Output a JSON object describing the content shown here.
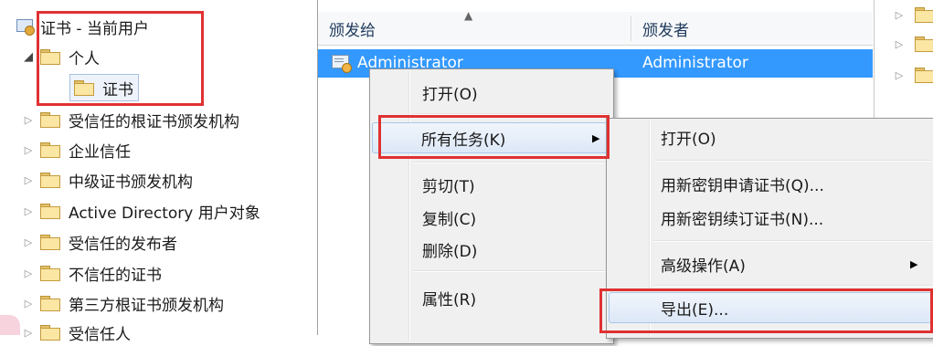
{
  "tree": {
    "root_label": "证书 - 当前用户",
    "personal_label": "个人",
    "certificates_label": "证书",
    "folders": [
      {
        "label": "受信任的根证书颁发机构"
      },
      {
        "label": "企业信任"
      },
      {
        "label": "中级证书颁发机构"
      },
      {
        "label": "Active Directory 用户对象"
      },
      {
        "label": "受信任的发布者"
      },
      {
        "label": "不信任的证书"
      },
      {
        "label": "第三方根证书颁发机构"
      },
      {
        "label": "受信任人"
      }
    ]
  },
  "list": {
    "columns": [
      {
        "label": "颁发给"
      },
      {
        "label": "颁发者"
      }
    ],
    "rows": [
      {
        "issued_to": "Administrator",
        "issued_by": "Administrator"
      }
    ]
  },
  "context_menu": {
    "items": [
      {
        "label": "打开(O)"
      },
      {
        "label": "所有任务(K)",
        "submenu_arrow": "▶"
      },
      {
        "label": "剪切(T)"
      },
      {
        "label": "复制(C)"
      },
      {
        "label": "删除(D)"
      },
      {
        "label": "属性(R)"
      }
    ]
  },
  "submenu": {
    "items": [
      {
        "label": "打开(O)"
      },
      {
        "label": "用新密钥申请证书(Q)..."
      },
      {
        "label": "用新密钥续订证书(N)..."
      },
      {
        "label": "高级操作(A)",
        "submenu_arrow": "▶"
      },
      {
        "label": "导出(E)..."
      }
    ]
  },
  "colors": {
    "selection_blue": "#3399ff",
    "highlight_red": "#e03131",
    "menu_bg": "#f0f0f0",
    "folder_yellow": "#fbe6a4"
  },
  "icons": {
    "expand": "▷",
    "collapse": "◢",
    "sort_up": "▲",
    "submenu": "▶"
  }
}
